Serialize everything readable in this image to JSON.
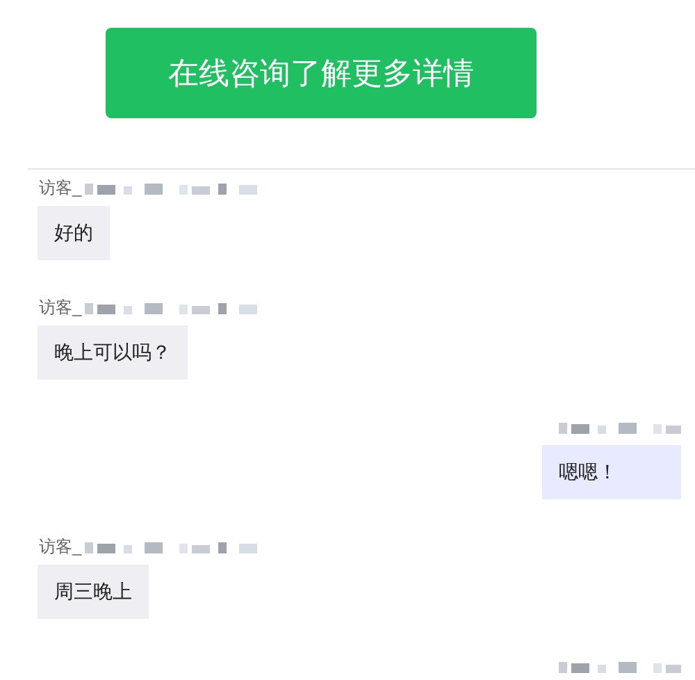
{
  "consult_button": {
    "label": "在线咨询了解更多详情"
  },
  "messages": [
    {
      "kind": "visitor",
      "sender": "访客_",
      "text": "好的"
    },
    {
      "kind": "visitor",
      "sender": "访客_",
      "text": "晚上可以吗？"
    },
    {
      "kind": "agent",
      "text": "嗯嗯！"
    },
    {
      "kind": "visitor",
      "sender": "访客_",
      "text": "周三晚上"
    },
    {
      "kind": "agent"
    }
  ]
}
